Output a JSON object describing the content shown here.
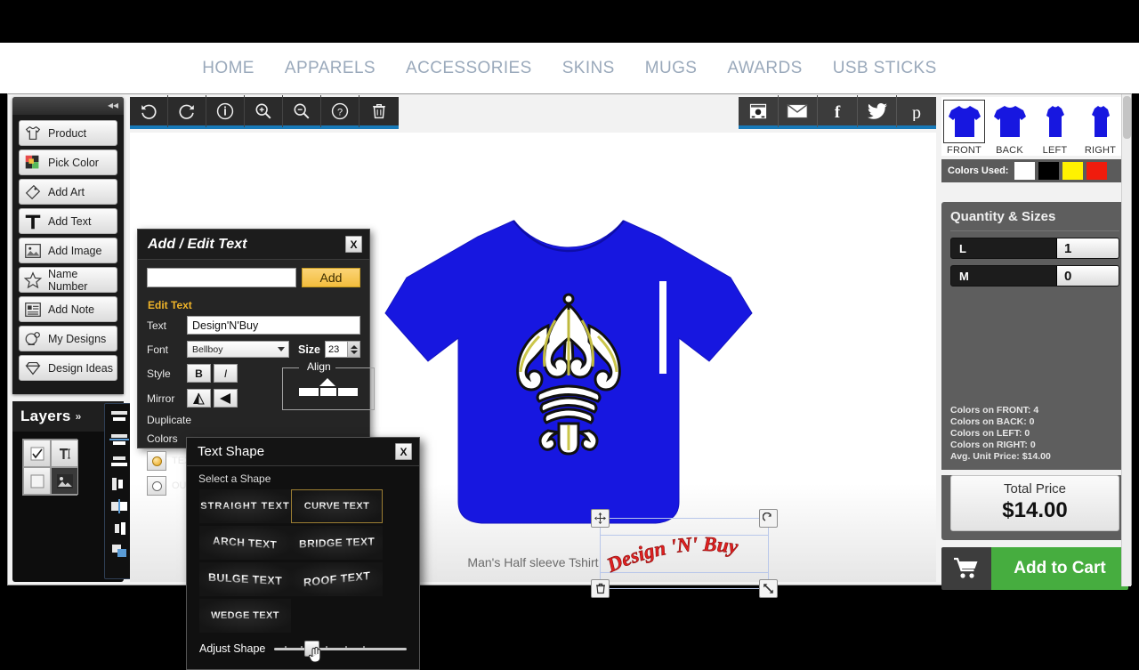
{
  "nav": {
    "items": [
      "HOME",
      "APPARELS",
      "ACCESSORIES",
      "SKINS",
      "MUGS",
      "AWARDS",
      "USB STICKS"
    ]
  },
  "tools": {
    "collapse_glyph": "◂◂",
    "items": [
      {
        "label": "Product",
        "icon": "tshirt-icon"
      },
      {
        "label": "Pick Color",
        "icon": "palette-icon"
      },
      {
        "label": "Add Art",
        "icon": "art-tag-icon"
      },
      {
        "label": "Add Text",
        "icon": "text-t-icon"
      },
      {
        "label": "Add Image",
        "icon": "image-icon"
      },
      {
        "label": "Name Number",
        "icon": "star-icon"
      },
      {
        "label": "Add Note",
        "icon": "note-icon"
      },
      {
        "label": "My Designs",
        "icon": "designs-icon"
      },
      {
        "label": "Design Ideas",
        "icon": "diamond-icon"
      }
    ]
  },
  "layers": {
    "title": "Layers",
    "chevron": "»",
    "cells": [
      "checkbox-checked-icon",
      "text-cursor-icon",
      "empty-square-icon",
      "image-thumb-icon"
    ],
    "align_buttons": [
      "align-top-icon",
      "align-vertical-center-icon",
      "align-bottom-icon",
      "align-left-icon",
      "align-horizontal-center-icon",
      "align-right-icon",
      "bring-forward-icon"
    ]
  },
  "canvas_toolbar": {
    "buttons": [
      {
        "name": "undo-icon",
        "title": "Undo"
      },
      {
        "name": "redo-icon",
        "title": "Redo"
      },
      {
        "name": "info-icon",
        "title": "Info"
      },
      {
        "name": "zoom-in-icon",
        "title": "Zoom In"
      },
      {
        "name": "zoom-out-icon",
        "title": "Zoom Out"
      },
      {
        "name": "help-icon",
        "title": "Help"
      },
      {
        "name": "trash-icon",
        "title": "Delete"
      }
    ]
  },
  "share_bar": {
    "buttons": [
      {
        "name": "screenshot-icon"
      },
      {
        "name": "email-icon"
      },
      {
        "name": "facebook-icon",
        "glyph": "f"
      },
      {
        "name": "twitter-icon"
      },
      {
        "name": "pinterest-icon",
        "glyph": "p"
      }
    ]
  },
  "canvas": {
    "product_label": "Man's Half sleeve Tshirt",
    "shirt_color": "#1717e0",
    "art": {
      "name": "fleur-de-lis-plume",
      "fill": "#ffffff",
      "shade": "#c9c341",
      "stroke": "#111111"
    },
    "design_text": {
      "value": "Design 'N' Buy",
      "color": "#e02020",
      "shape": "curve"
    },
    "handles": [
      "move-handle",
      "rotate-handle",
      "delete-handle",
      "resize-handle"
    ]
  },
  "views": {
    "items": [
      {
        "label": "FRONT",
        "active": true
      },
      {
        "label": "BACK",
        "active": false
      },
      {
        "label": "LEFT",
        "active": false
      },
      {
        "label": "RIGHT",
        "active": false
      }
    ]
  },
  "colors_used": {
    "label": "Colors Used:",
    "swatches": [
      "#ffffff",
      "#000000",
      "#fff200",
      "#f01c0d"
    ]
  },
  "quantity": {
    "title": "Quantity &  Sizes",
    "rows": [
      {
        "size": "L",
        "qty": "1"
      },
      {
        "size": "M",
        "qty": "0"
      }
    ]
  },
  "color_info": {
    "lines": [
      "Colors on FRONT: 4",
      "Colors on BACK: 0",
      "Colors on LEFT: 0",
      "Colors on RIGHT: 0",
      "Avg. Unit Price: $14.00"
    ]
  },
  "total": {
    "label": "Total Price",
    "value": "$14.00"
  },
  "cart": {
    "label": "Add to Cart",
    "icon": "shopping-cart-icon",
    "color": "#46ad3f"
  },
  "text_dialog": {
    "title": "Add / Edit Text",
    "close": "X",
    "add_input_value": "",
    "add_input_placeholder": "",
    "add_button": "Add",
    "section_label": "Edit Text",
    "text_label": "Text",
    "text_value": "Design'N'Buy",
    "font_label": "Font",
    "font_value": "Bellboy",
    "size_label": "Size",
    "size_value": "23",
    "style_label": "Style",
    "style_bold": "B",
    "style_italic": "I",
    "mirror_label": "Mirror",
    "align_label": "Align",
    "duplicate_label": "Duplicate",
    "colors_label": "Colors",
    "fill_option": "TEXT",
    "outline_option": "OUTLINE"
  },
  "shape_dialog": {
    "title": "Text Shape",
    "close": "X",
    "subtitle": "Select a Shape",
    "shapes": [
      {
        "label": "STRAIGHT TEXT",
        "selected": false
      },
      {
        "label": "CURVE TEXT",
        "selected": true
      },
      {
        "label": "ARCH TEXT",
        "selected": false
      },
      {
        "label": "BRIDGE TEXT",
        "selected": false
      },
      {
        "label": "BULGE TEXT",
        "selected": false
      },
      {
        "label": "ROOF TEXT",
        "selected": false
      },
      {
        "label": "WEDGE TEXT",
        "selected": false
      }
    ],
    "adjust_label": "Adjust Shape",
    "adjust_value": "30"
  }
}
